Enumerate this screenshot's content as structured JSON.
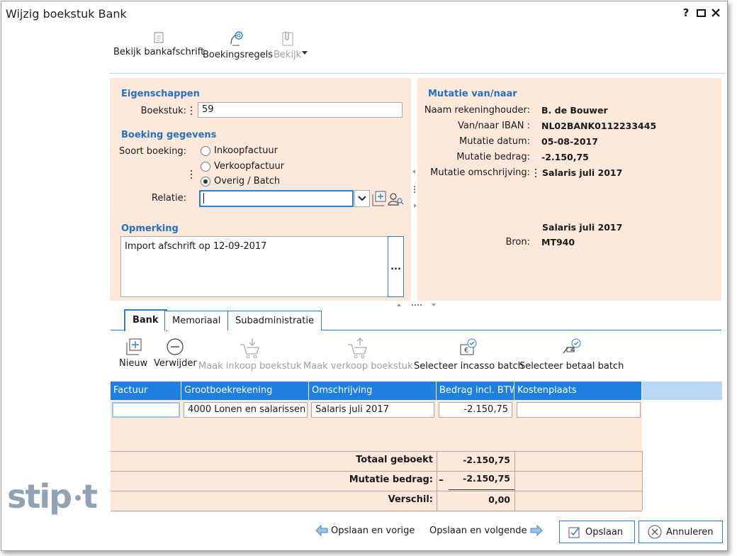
{
  "window": {
    "title": "Wijzig boekstuk Bank"
  },
  "toolbar": {
    "bekijk_bankafschrift": "Bekijk bankafschrift",
    "boekingsregels": "Boekingsregels",
    "bekijk": "Bekijk"
  },
  "eigenschappen": {
    "title": "Eigenschappen",
    "boekstuk_label": "Boekstuk:",
    "boekstuk_value": "59"
  },
  "boeking": {
    "title": "Boeking gegevens",
    "soort_label": "Soort boeking:",
    "options": [
      "Inkoopfactuur",
      "Verkoopfactuur",
      "Overig / Batch"
    ],
    "selected": "Overig / Batch",
    "relatie_label": "Relatie:",
    "relatie_value": ""
  },
  "opmerking": {
    "title": "Opmerking",
    "text": "Import afschrift op 12-09-2017",
    "more": "..."
  },
  "mutatie": {
    "title": "Mutatie van/naar",
    "rows": [
      {
        "label": "Naam rekeninghouder:",
        "value": "B. de Bouwer"
      },
      {
        "label": "Van/naar IBAN :",
        "value": "NL02BANK0112233445"
      },
      {
        "label": "Mutatie datum:",
        "value": "05-08-2017"
      },
      {
        "label": "Mutatie bedrag:",
        "value": "-2.150,75"
      },
      {
        "label": "Mutatie omschrijving:",
        "value": "Salaris juli 2017"
      }
    ],
    "omschrijving_extra": "Salaris juli 2017",
    "bron_label": "Bron:",
    "bron_value": "MT940"
  },
  "tabs": [
    "Bank",
    "Memoriaal",
    "Subadministratie"
  ],
  "actions": {
    "nieuw": "Nieuw",
    "verwijder": "Verwijder",
    "maak_inkoop": "Maak inkoop boekstuk",
    "maak_verkoop": "Maak verkoop boekstuk",
    "selecteer_incasso": "Selecteer incasso batch",
    "selecteer_betaal": "Selecteer betaal batch"
  },
  "grid": {
    "columns": [
      "Factuur",
      "Grootboekrekening",
      "Omschrijving",
      "Bedrag incl. BTW",
      "Kostenplaats"
    ],
    "rows": [
      {
        "factuur": "",
        "grootboek": "4000 Lonen en salarissen",
        "omschrijving": "Salaris juli 2017",
        "bedrag": "-2.150,75",
        "kostenplaats": ""
      }
    ]
  },
  "totals": {
    "totaal_label": "Totaal geboekt",
    "totaal_value": "-2.150,75",
    "mutatie_label": "Mutatie bedrag:",
    "mutatie_sign": "–",
    "mutatie_value": "-2.150,75",
    "verschil_label": "Verschil:",
    "verschil_value": "0,00"
  },
  "footer": {
    "vorige": "Opslaan en vorige",
    "volgende": "Opslaan en volgende",
    "opslaan": "Opslaan",
    "annuleren": "Annuleren"
  },
  "logo_text": "stip·t",
  "colors": {
    "accent": "#1e7fe0",
    "panel": "#fde9dc",
    "section": "#2670c0"
  }
}
